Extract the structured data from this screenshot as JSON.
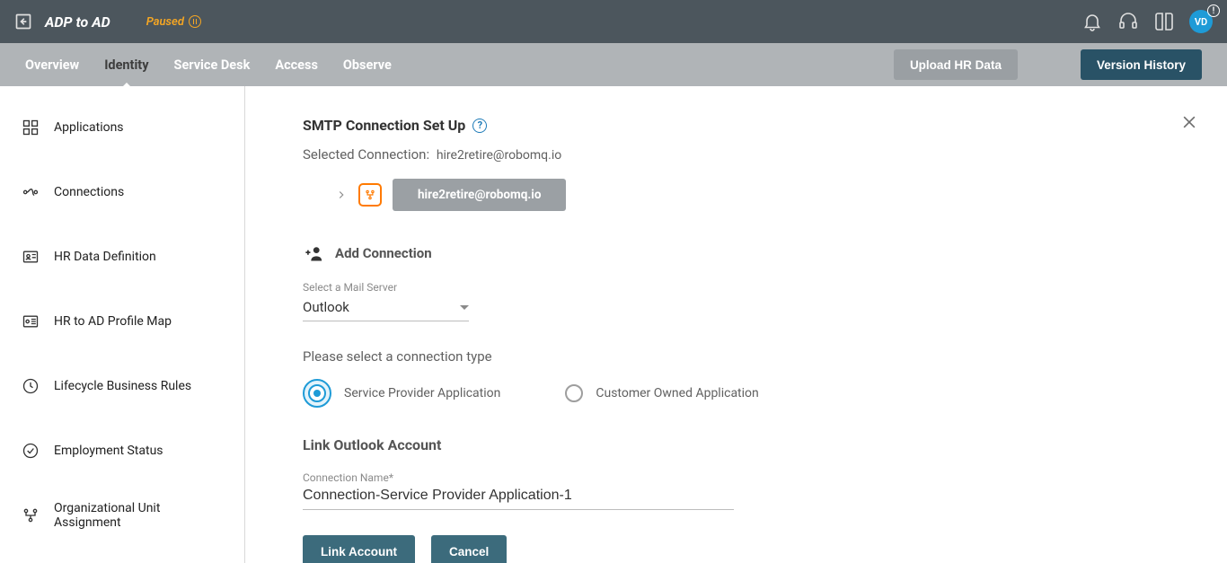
{
  "header": {
    "title": "ADP to AD",
    "status": "Paused",
    "avatar_initials": "VD"
  },
  "nav": {
    "tabs": [
      "Overview",
      "Identity",
      "Service Desk",
      "Access",
      "Observe"
    ],
    "active_index": 1,
    "upload_btn": "Upload HR Data",
    "history_btn": "Version History"
  },
  "sidebar": {
    "items": [
      {
        "label": "Applications"
      },
      {
        "label": "Connections"
      },
      {
        "label": "HR Data Definition"
      },
      {
        "label": "HR to AD Profile Map"
      },
      {
        "label": "Lifecycle Business Rules"
      },
      {
        "label": "Employment Status"
      },
      {
        "label": "Organizational Unit Assignment"
      }
    ]
  },
  "main": {
    "title": "SMTP Connection Set Up",
    "selected_label": "Selected Connection:",
    "selected_value": "hire2retire@robomq.io",
    "chip": "hire2retire@robomq.io",
    "add_label": "Add Connection",
    "mail_server_label": "Select a Mail Server",
    "mail_server_value": "Outlook",
    "conn_type_prompt": "Please select a connection type",
    "radio_a": "Service Provider Application",
    "radio_b": "Customer Owned Application",
    "link_section_title": "Link Outlook Account",
    "conn_name_label": "Connection Name*",
    "conn_name_value": "Connection-Service Provider Application-1",
    "link_btn": "Link Account",
    "cancel_btn": "Cancel"
  }
}
